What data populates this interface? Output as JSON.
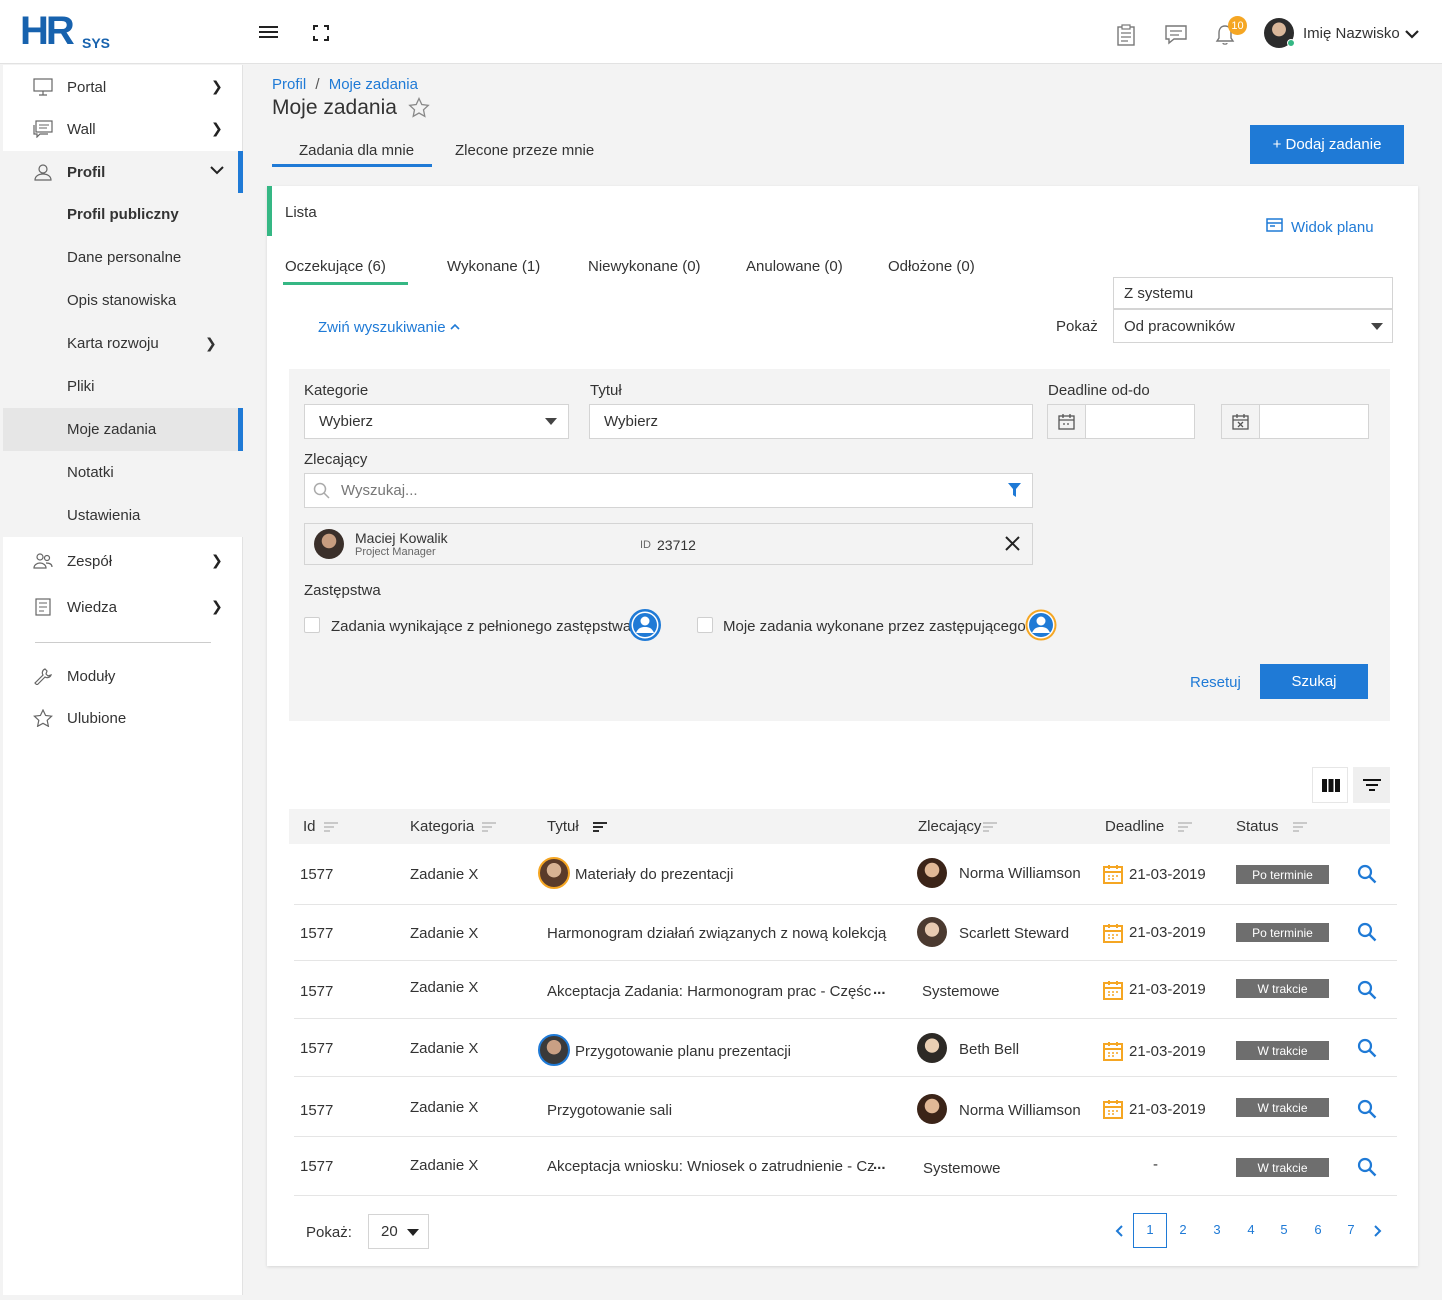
{
  "header": {
    "logo_main": "HR",
    "logo_sub": "SYS",
    "notification_count": "10",
    "user_name": "Imię Nazwisko"
  },
  "sidebar": {
    "items": [
      {
        "label": "Portal"
      },
      {
        "label": "Wall"
      },
      {
        "label": "Profil"
      },
      {
        "label": "Profil publiczny"
      },
      {
        "label": "Dane personalne"
      },
      {
        "label": "Opis stanowiska"
      },
      {
        "label": "Karta rozwoju"
      },
      {
        "label": "Pliki"
      },
      {
        "label": "Moje zadania"
      },
      {
        "label": "Notatki"
      },
      {
        "label": "Ustawienia"
      },
      {
        "label": "Zespół"
      },
      {
        "label": "Wiedza"
      },
      {
        "label": "Moduły"
      },
      {
        "label": "Ulubione"
      }
    ]
  },
  "breadcrumb": {
    "root": "Profil",
    "sep": "/",
    "current": "Moje zadania"
  },
  "page_title": "Moje zadania",
  "top_tabs": [
    "Zadania dla mnie",
    "Zlecone przeze mnie"
  ],
  "add_button": "+ Dodaj zadanie",
  "card": {
    "section_title": "Lista",
    "plan_view": "Widok planu",
    "status_tabs": [
      "Oczekujące (6)",
      "Wykonane (1)",
      "Niewykonane (0)",
      "Anulowane (0)",
      "Odłożone (0)"
    ],
    "collapse_search": "Zwiń wyszukiwanie",
    "show_label": "Pokaż",
    "source_option_top": "Z systemu",
    "source_option_selected": "Od pracowników"
  },
  "filters": {
    "category_label": "Kategorie",
    "category_value": "Wybierz",
    "title_label": "Tytuł",
    "title_value": "Wybierz",
    "deadline_label": "Deadline od-do",
    "ordering_label": "Zlecający",
    "search_placeholder": "Wyszukaj...",
    "person_name": "Maciej Kowalik",
    "person_role": "Project Manager",
    "person_id_label": "ID",
    "person_id": "23712",
    "substitutions_label": "Zastępstwa",
    "sub_option_1": "Zadania wynikające z pełnionego zastępstwa",
    "sub_option_2": "Moje zadania wykonane przez zastępującego",
    "reset": "Resetuj",
    "search": "Szukaj"
  },
  "table": {
    "headers": [
      "Id",
      "Kategoria",
      "Tytuł",
      "Zlecający",
      "Deadline",
      "Status"
    ],
    "rows": [
      {
        "id": "1577",
        "category": "Zadanie X",
        "title": "Materiały do prezentacji",
        "ordering": "Norma Williamson",
        "deadline": "21-03-2019",
        "status": "Po terminie"
      },
      {
        "id": "1577",
        "category": "Zadanie X",
        "title": "Harmonogram działań związanych z nową kolekcją",
        "ordering": "Scarlett Steward",
        "deadline": "21-03-2019",
        "status": "Po terminie"
      },
      {
        "id": "1577",
        "category": "Zadanie X",
        "title": "Akceptacja Zadania: Harmonogram prac  - Częśc",
        "ordering": "Systemowe",
        "deadline": "21-03-2019",
        "status": "W trakcie"
      },
      {
        "id": "1577",
        "category": "Zadanie X",
        "title": "Przygotowanie planu prezentacji",
        "ordering": "Beth Bell",
        "deadline": "21-03-2019",
        "status": "W trakcie"
      },
      {
        "id": "1577",
        "category": "Zadanie X",
        "title": "Przygotowanie sali",
        "ordering": "Norma Williamson",
        "deadline": "21-03-2019",
        "status": "W trakcie"
      },
      {
        "id": "1577",
        "category": "Zadanie X",
        "title": "Akceptacja wniosku: Wniosek o zatrudnienie - Cz",
        "ordering": "Systemowe",
        "deadline": "-",
        "status": "W trakcie"
      }
    ],
    "ellipsis": "..."
  },
  "pagination": {
    "show_label": "Pokaż:",
    "page_size": "20",
    "pages": [
      "1",
      "2",
      "3",
      "4",
      "5",
      "6",
      "7"
    ]
  },
  "colors": {
    "accent": "#1f7ad6",
    "green": "#35b784",
    "badge": "#6e6e6e",
    "notif": "#f5a623"
  }
}
